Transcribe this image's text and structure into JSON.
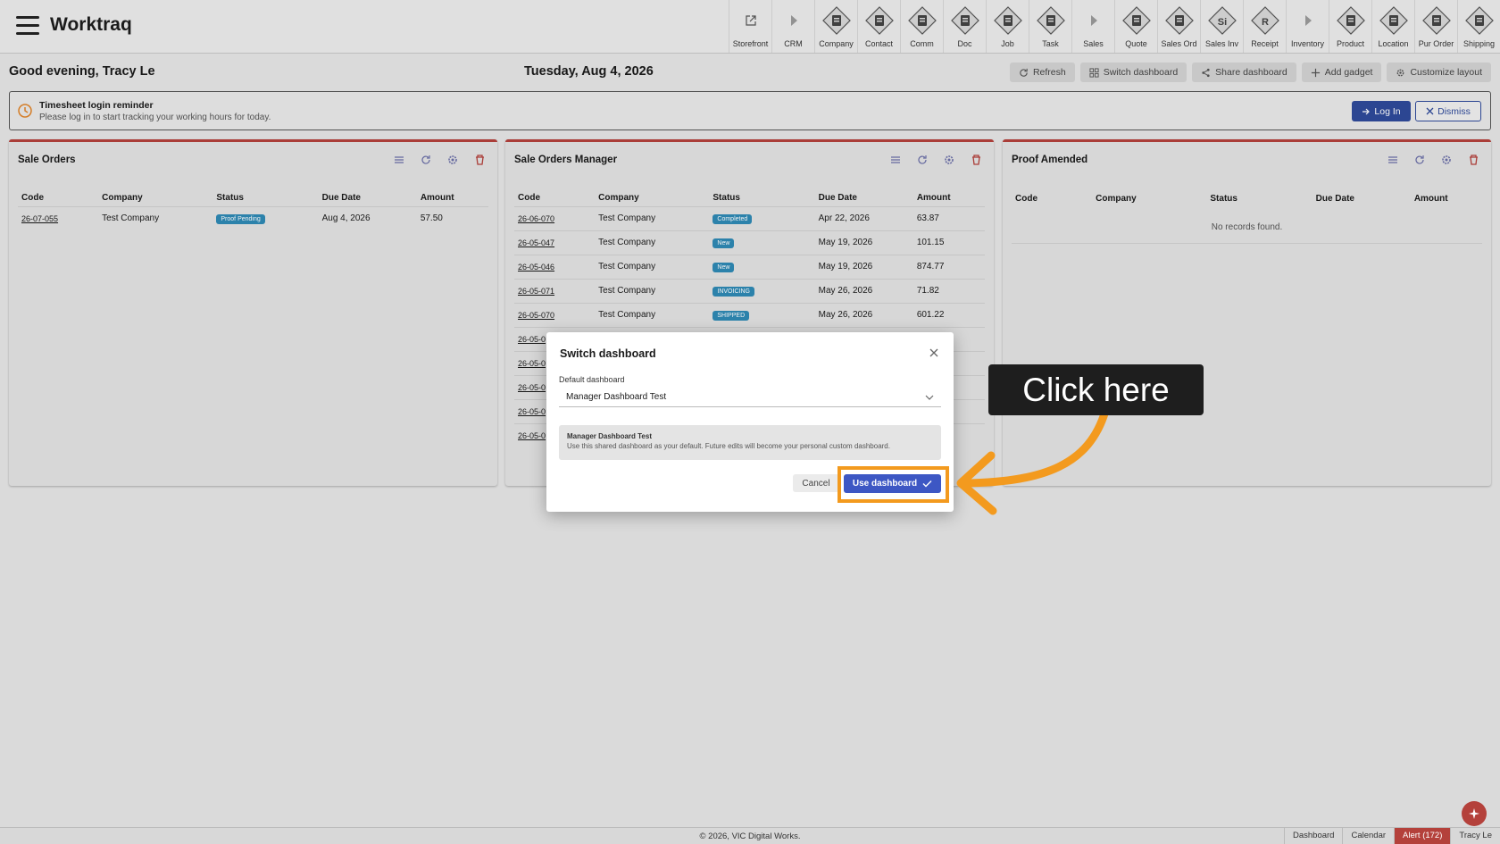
{
  "app": {
    "title": "Worktraq"
  },
  "modules": [
    {
      "label": "Storefront",
      "icon": "external-link-icon"
    },
    {
      "label": "CRM",
      "icon": "play-icon"
    },
    {
      "label": "Company",
      "icon": "company-icon"
    },
    {
      "label": "Contact",
      "icon": "contact-icon"
    },
    {
      "label": "Comm",
      "icon": "comm-icon"
    },
    {
      "label": "Doc",
      "icon": "doc-icon"
    },
    {
      "label": "Job",
      "icon": "job-icon"
    },
    {
      "label": "Task",
      "icon": "task-icon"
    },
    {
      "label": "Sales",
      "icon": "play-icon"
    },
    {
      "label": "Quote",
      "icon": "quote-icon"
    },
    {
      "label": "Sales Ord",
      "icon": "sales-order-icon"
    },
    {
      "label": "Sales Inv",
      "icon": "sales-invoice-icon",
      "glyph": "Si"
    },
    {
      "label": "Receipt",
      "icon": "receipt-icon",
      "glyph": "R"
    },
    {
      "label": "Inventory",
      "icon": "play-icon"
    },
    {
      "label": "Product",
      "icon": "product-icon"
    },
    {
      "label": "Location",
      "icon": "location-icon"
    },
    {
      "label": "Pur Order",
      "icon": "purchase-order-icon"
    },
    {
      "label": "Shipping",
      "icon": "shipping-icon"
    }
  ],
  "header": {
    "greeting": "Good evening, Tracy Le",
    "date": "Tuesday, Aug 4, 2026",
    "actions": [
      "Refresh",
      "Switch dashboard",
      "Share dashboard",
      "Add gadget",
      "Customize layout"
    ]
  },
  "reminder": {
    "title": "Timesheet login reminder",
    "text": "Please log in to start tracking your working hours for today.",
    "login": "Log In",
    "dismiss": "Dismiss"
  },
  "columns": [
    "Code",
    "Company",
    "Status",
    "Due Date",
    "Amount"
  ],
  "gadgets": [
    {
      "title": "Sale Orders",
      "rows": [
        [
          "26-07-055",
          "Test Company",
          "Proof Pending",
          "Aug 4, 2026",
          "57.50"
        ]
      ]
    },
    {
      "title": "Sale Orders Manager",
      "rows": [
        [
          "26-06-070",
          "Test Company",
          "Completed",
          "Apr 22, 2026",
          "63.87"
        ],
        [
          "26-05-047",
          "Test Company",
          "New",
          "May 19, 2026",
          "101.15"
        ],
        [
          "26-05-046",
          "Test Company",
          "New",
          "May 19, 2026",
          "874.77"
        ],
        [
          "26-05-071",
          "Test Company",
          "INVOICING",
          "May 26, 2026",
          "71.82"
        ],
        [
          "26-05-070",
          "Test Company",
          "SHIPPED",
          "May 26, 2026",
          "601.22"
        ],
        [
          "26-05-0",
          "",
          "",
          "",
          ""
        ],
        [
          "26-05-0",
          "",
          "",
          "",
          ""
        ],
        [
          "26-05-0",
          "",
          "",
          "",
          ""
        ],
        [
          "26-05-0",
          "",
          "",
          "",
          ""
        ],
        [
          "26-05-0",
          "",
          "",
          "",
          ""
        ]
      ]
    },
    {
      "title": "Proof Amended",
      "rows": [],
      "empty": "No records found."
    }
  ],
  "dialog": {
    "title": "Switch dashboard",
    "label": "Default dashboard",
    "selected": "Manager Dashboard Test",
    "info_title": "Manager Dashboard Test",
    "info_text": "Use this shared dashboard as your default. Future edits will become your personal custom dashboard.",
    "cancel": "Cancel",
    "use": "Use dashboard"
  },
  "callout": {
    "text": "Click here"
  },
  "footer": {
    "copyright": "© 2026, VIC Digital Works.",
    "links": [
      "Dashboard",
      "Calendar",
      "Alert (172)",
      "Tracy Le"
    ]
  },
  "colors": {
    "accent": "#b4413b",
    "primary": "#3d57c4",
    "highlight": "#f39a1e"
  }
}
